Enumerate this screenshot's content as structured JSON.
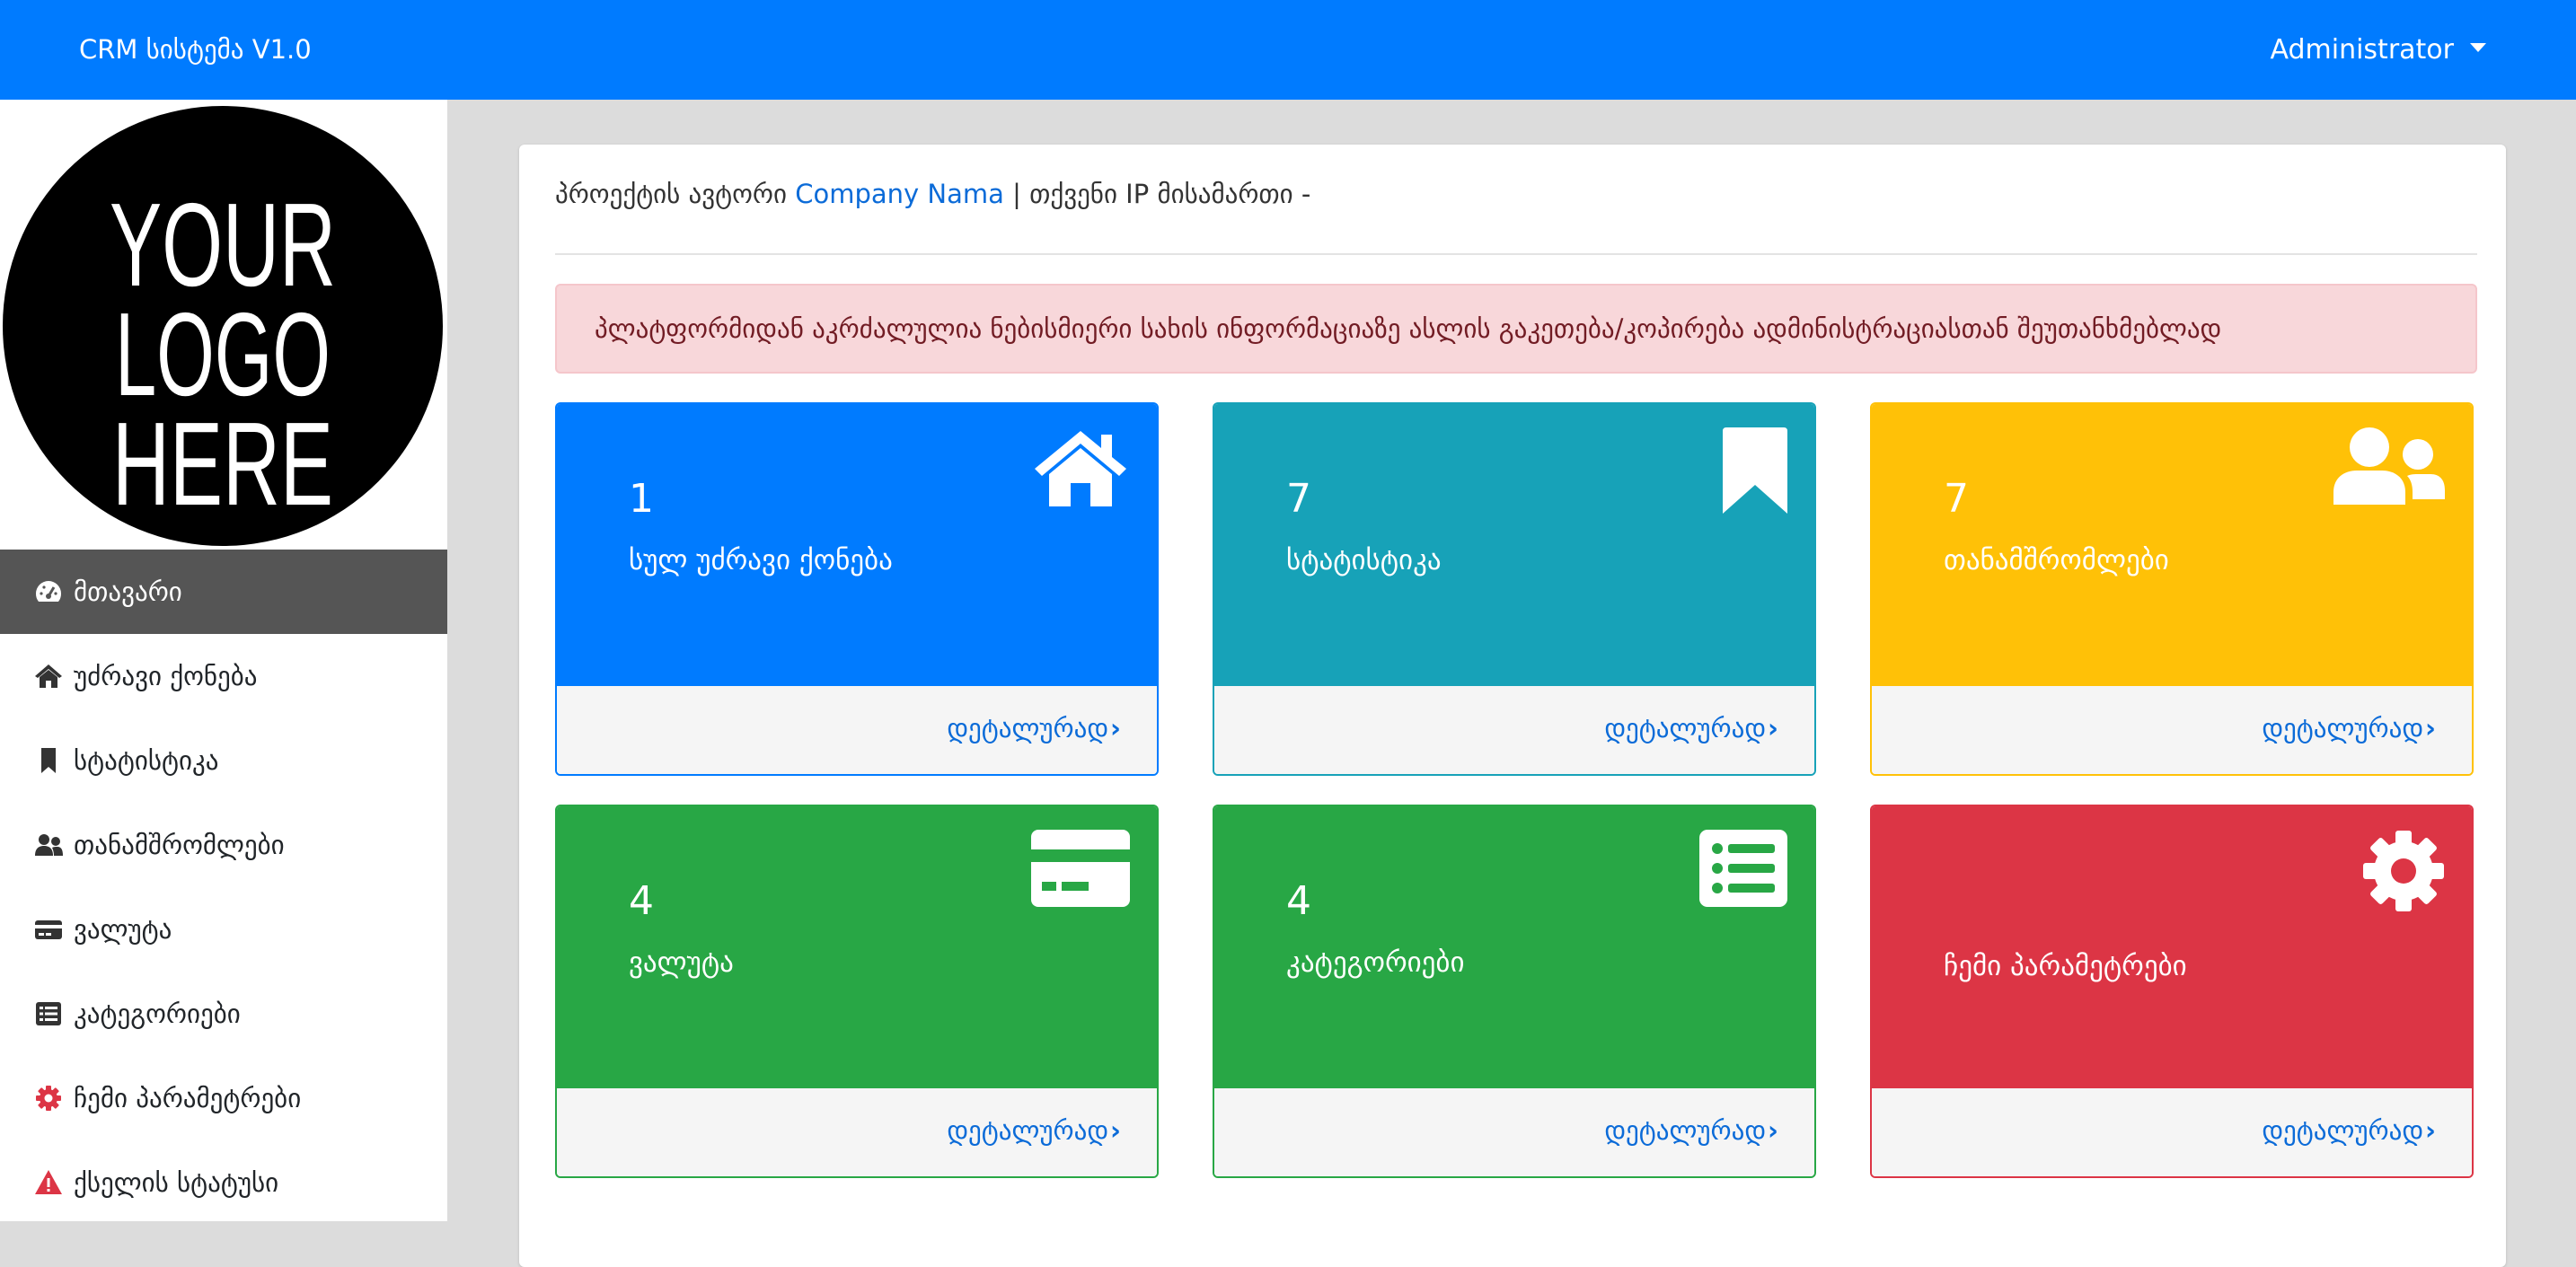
{
  "header": {
    "brand": "CRM სისტემა V1.0",
    "user": "Administrator"
  },
  "sidebar": {
    "logo_text": [
      "YOUR",
      "LOGO",
      "HERE"
    ],
    "items": [
      {
        "label": "მთავარი",
        "icon": "dashboard-icon",
        "active": true
      },
      {
        "label": "უძრავი ქონება",
        "icon": "home-icon"
      },
      {
        "label": "სტატისტიკა",
        "icon": "bookmark-icon"
      },
      {
        "label": "თანამშრომლები",
        "icon": "users-icon"
      },
      {
        "label": "ვალუტა",
        "icon": "credit-card-icon"
      },
      {
        "label": "კატეგორიები",
        "icon": "list-icon"
      },
      {
        "label": "ჩემი პარამეტრები",
        "icon": "gear-icon",
        "icon_color": "#dc3545"
      },
      {
        "label": "ქსელის სტატუსი",
        "icon": "warning-icon",
        "icon_color": "#dc3545"
      }
    ]
  },
  "main": {
    "author_prefix": "პროექტის ავტორი",
    "author_name": "Company Nama",
    "ip_text": "| თქვენი IP მისამართი -",
    "alert": "პლატფორმიდან აკრძალულია ნებისმიერი სახის ინფორმაციაზე ასლის გაკეთება/კოპირება ადმინისტრაციასთან შეუთანხმებლად",
    "tiles": [
      {
        "count": "1",
        "label": "სულ უძრავი ქონება",
        "icon": "home-icon",
        "color": "#007bff",
        "link": "დეტალურად"
      },
      {
        "count": "7",
        "label": "სტატისტიკა",
        "icon": "bookmark-icon",
        "color": "#17a2b8",
        "link": "დეტალურად"
      },
      {
        "count": "7",
        "label": "თანამშრომლები",
        "icon": "users-icon",
        "color": "#ffc107",
        "link": "დეტალურად"
      },
      {
        "count": "4",
        "label": "ვალუტა",
        "icon": "credit-card-icon",
        "color": "#28a745",
        "link": "დეტალურად"
      },
      {
        "count": "4",
        "label": "კატეგორიები",
        "icon": "list-icon",
        "color": "#28a745",
        "link": "დეტალურად"
      },
      {
        "count": "",
        "label": "ჩემი პარამეტრები",
        "icon": "gear-icon",
        "color": "#dc3545",
        "link": "დეტალურად"
      }
    ]
  }
}
